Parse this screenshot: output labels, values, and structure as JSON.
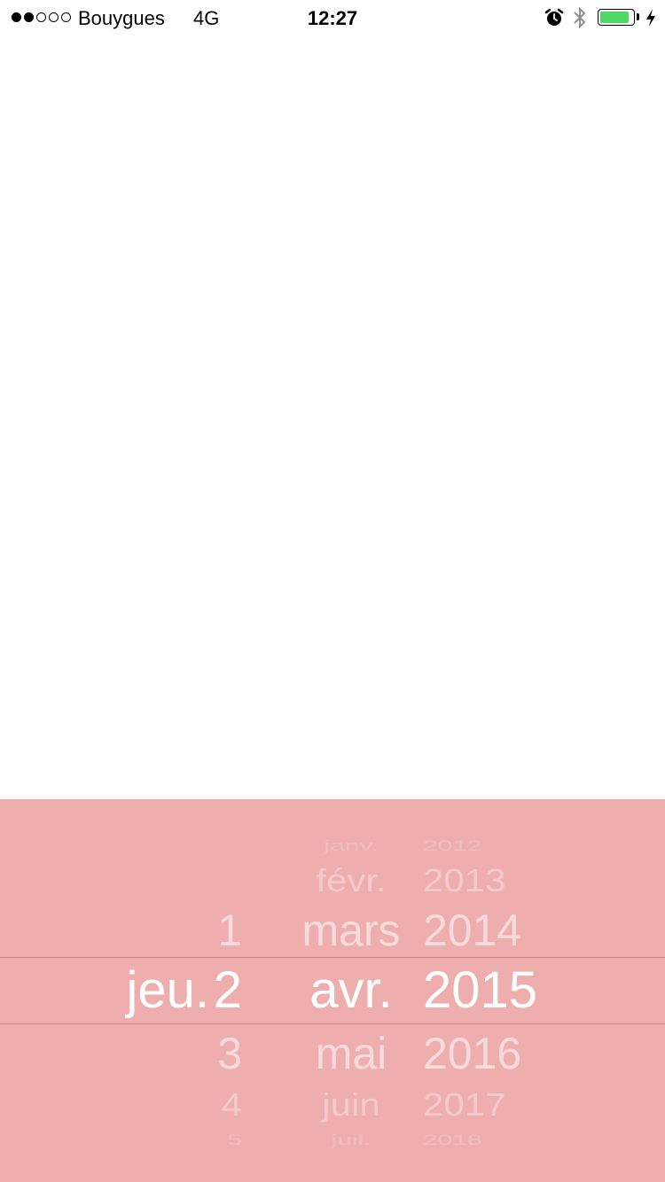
{
  "status_bar": {
    "carrier": "Bouygues",
    "network": "4G",
    "time": "12:27",
    "signal_bars_filled": 2,
    "signal_bars_total": 5,
    "battery_level": 0.9,
    "battery_color": "#4cd964"
  },
  "picker": {
    "background_color": "#efaeae",
    "weekday_selected": "jeu.",
    "days": [
      "1",
      "2",
      "3",
      "4",
      "5"
    ],
    "months": [
      "janv.",
      "févr.",
      "mars",
      "avr.",
      "mai",
      "juin",
      "juil."
    ],
    "years": [
      "2012",
      "2013",
      "2014",
      "2015",
      "2016",
      "2017",
      "2018"
    ],
    "selected": {
      "weekday": "jeu.",
      "day": "2",
      "month": "avr.",
      "year": "2015"
    }
  }
}
